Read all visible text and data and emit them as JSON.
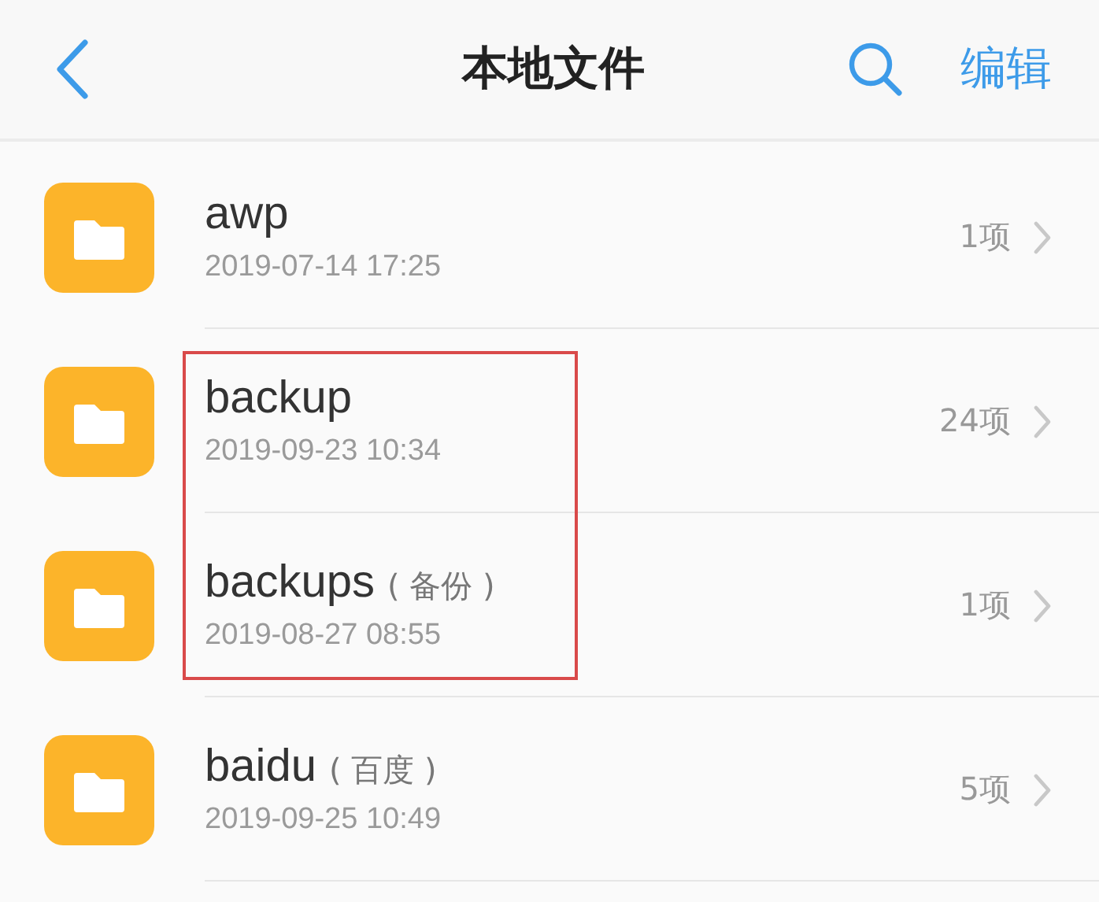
{
  "header": {
    "title": "本地文件",
    "action": "编辑"
  },
  "folders": [
    {
      "name": "awp",
      "date": "2019-07-14 17:25",
      "count": "1项",
      "highlighted": false
    },
    {
      "name": "backup",
      "date": "2019-09-23 10:34",
      "count": "24项",
      "highlighted": true
    },
    {
      "name": "backups",
      "alias": "( 备份 )",
      "date": "2019-08-27 08:55",
      "count": "1项",
      "highlighted": true
    },
    {
      "name": "baidu",
      "alias": "( 百度 )",
      "date": "2019-09-25 10:49",
      "count": "5项",
      "highlighted": false
    }
  ]
}
